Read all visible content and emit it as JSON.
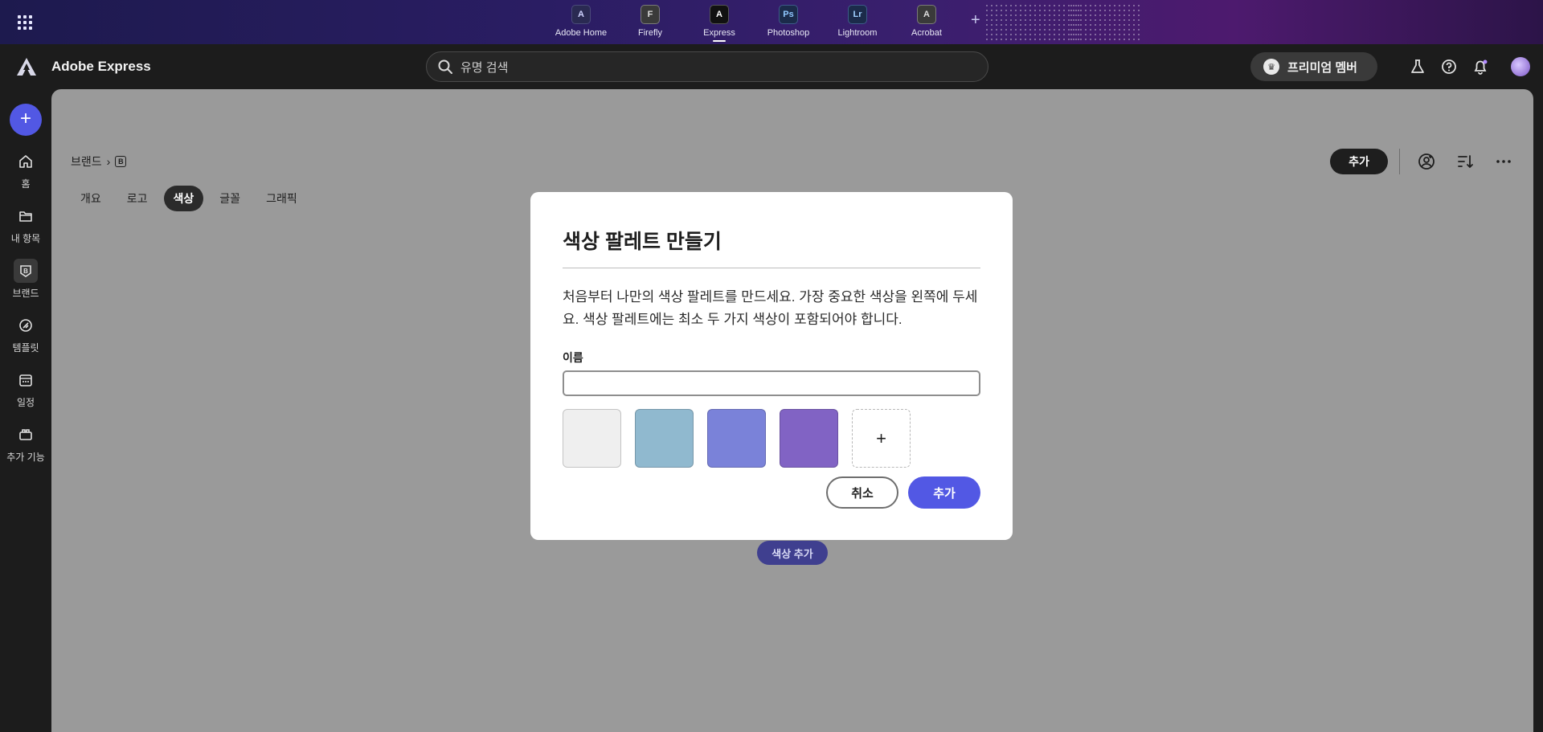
{
  "topbar": {
    "apps": [
      {
        "label": "Adobe Home",
        "icon": "adobe-a-icon",
        "glyph": "A"
      },
      {
        "label": "Firefly",
        "icon": "firefly-icon",
        "glyph": "F"
      },
      {
        "label": "Express",
        "icon": "express-icon",
        "glyph": "A"
      },
      {
        "label": "Photoshop",
        "icon": "photoshop-icon",
        "glyph": "Ps"
      },
      {
        "label": "Lightroom",
        "icon": "lightroom-icon",
        "glyph": "Lr"
      },
      {
        "label": "Acrobat",
        "icon": "acrobat-icon",
        "glyph": "A"
      }
    ],
    "active_app": "Express",
    "add_symbol": "+"
  },
  "header": {
    "brand_name": "Adobe Express",
    "search_placeholder": "유명 검색",
    "premium_label": "프리미엄 멤버"
  },
  "rail": {
    "create_symbol": "+",
    "items": [
      {
        "label": "홈",
        "icon": "home-icon"
      },
      {
        "label": "내 항목",
        "icon": "folder-icon"
      },
      {
        "label": "브랜드",
        "icon": "brand-icon",
        "active": true
      },
      {
        "label": "템플릿",
        "icon": "template-icon"
      },
      {
        "label": "일정",
        "icon": "calendar-icon"
      },
      {
        "label": "추가 기능",
        "icon": "addons-icon"
      }
    ]
  },
  "main": {
    "breadcrumb": {
      "root": "브랜드",
      "separator": "›",
      "brand_glyph": "B"
    },
    "tabs": [
      {
        "label": "개요"
      },
      {
        "label": "로고"
      },
      {
        "label": "색상",
        "active": true
      },
      {
        "label": "글꼴"
      },
      {
        "label": "그래픽"
      }
    ],
    "add_button": "추가",
    "add_color_button": "색상 추가"
  },
  "modal": {
    "title": "색상 팔레트 만들기",
    "description": "처음부터 나만의 색상 팔레트를 만드세요. 가장 중요한 색상을 왼쪽에 두세요. 색상 팔레트에는 최소 두 가지 색상이 포함되어야 합니다.",
    "name_label": "이름",
    "name_value": "",
    "swatches": [
      "#efefef",
      "#90b9cf",
      "#7a82d9",
      "#8163c4"
    ],
    "add_swatch_symbol": "+",
    "cancel_label": "취소",
    "confirm_label": "추가"
  },
  "colors": {
    "accent": "#5258e4",
    "overlay": "#9a9a9a",
    "topbar_start": "#1d1a4e",
    "topbar_end": "#4d1a6e"
  }
}
